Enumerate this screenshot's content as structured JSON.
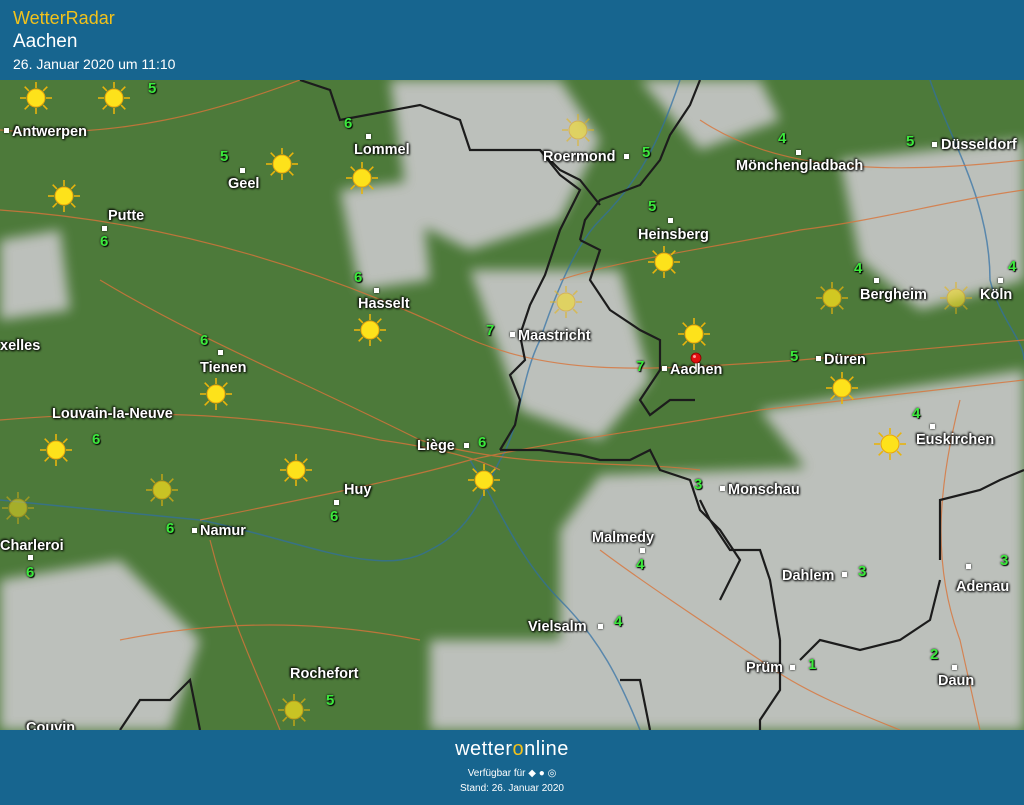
{
  "header": {
    "app_title": "WetterRadar",
    "city": "Aachen",
    "timestamp": "26. Januar 2020 um 11:10"
  },
  "colors": {
    "header_bg": "#17658f",
    "accent": "#f2c21b",
    "land": "#4d7a3a",
    "temp_text": "#3ce83c"
  },
  "map": {
    "places": [
      {
        "id": "antwerpen",
        "label": "Antwerpen"
      },
      {
        "id": "lommel",
        "label": "Lommel"
      },
      {
        "id": "geel",
        "label": "Geel"
      },
      {
        "id": "putte",
        "label": "Putte"
      },
      {
        "id": "roermond",
        "label": "Roermond"
      },
      {
        "id": "monchengladbach",
        "label": "Mönchengladbach"
      },
      {
        "id": "dusseldorf",
        "label": "Düsseldorf"
      },
      {
        "id": "heinsberg",
        "label": "Heinsberg"
      },
      {
        "id": "hasselt",
        "label": "Hasselt"
      },
      {
        "id": "maastricht",
        "label": "Maastricht"
      },
      {
        "id": "bergheim",
        "label": "Bergheim"
      },
      {
        "id": "koln",
        "label": "Köln"
      },
      {
        "id": "bruxelles",
        "label": "xelles"
      },
      {
        "id": "tienen",
        "label": "Tienen"
      },
      {
        "id": "aachen",
        "label": "Aachen"
      },
      {
        "id": "duren",
        "label": "Düren"
      },
      {
        "id": "louvain",
        "label": "Louvain-la-Neuve"
      },
      {
        "id": "liege",
        "label": "Liège"
      },
      {
        "id": "euskirchen",
        "label": "Euskirchen"
      },
      {
        "id": "huy",
        "label": "Huy"
      },
      {
        "id": "monschau",
        "label": "Monschau"
      },
      {
        "id": "charleroi",
        "label": "Charleroi"
      },
      {
        "id": "namur",
        "label": "Namur"
      },
      {
        "id": "malmedy",
        "label": "Malmedy"
      },
      {
        "id": "dahlem",
        "label": "Dahlem"
      },
      {
        "id": "adenau",
        "label": "Adenau"
      },
      {
        "id": "vielsalm",
        "label": "Vielsalm"
      },
      {
        "id": "prum",
        "label": "Prüm"
      },
      {
        "id": "rochefort",
        "label": "Rochefort"
      },
      {
        "id": "daun",
        "label": "Daun"
      },
      {
        "id": "couvin",
        "label": "Couvin"
      }
    ],
    "temperatures": [
      "5",
      "6",
      "5",
      "6",
      "5",
      "4",
      "5",
      "5",
      "6",
      "7",
      "4",
      "4",
      "6",
      "7",
      "5",
      "6",
      "6",
      "4",
      "6",
      "3",
      "6",
      "4",
      "3",
      "3",
      "4",
      "2",
      "1",
      "5",
      "6"
    ],
    "weather_icons": [
      "sun-icon",
      "sun-icon",
      "sun-icon",
      "sun-icon",
      "sun-icon",
      "sun-icon",
      "sun-icon",
      "sun-icon",
      "sun-icon",
      "sun-icon",
      "sun-icon",
      "sun-icon",
      "sun-icon",
      "sun-icon",
      "sun-icon",
      "sun-icon",
      "sun-icon",
      "sun-icon",
      "sun-icon",
      "sun-icon",
      "sun-icon"
    ],
    "location_pin": "location-pin-icon"
  },
  "footer": {
    "logo_a": "wetter",
    "logo_b": "o",
    "logo_c": "nline",
    "availability": "Verfügbar für",
    "platform_icons": "◆ ● ◎",
    "as_of": "Stand: 26. Januar 2020"
  }
}
